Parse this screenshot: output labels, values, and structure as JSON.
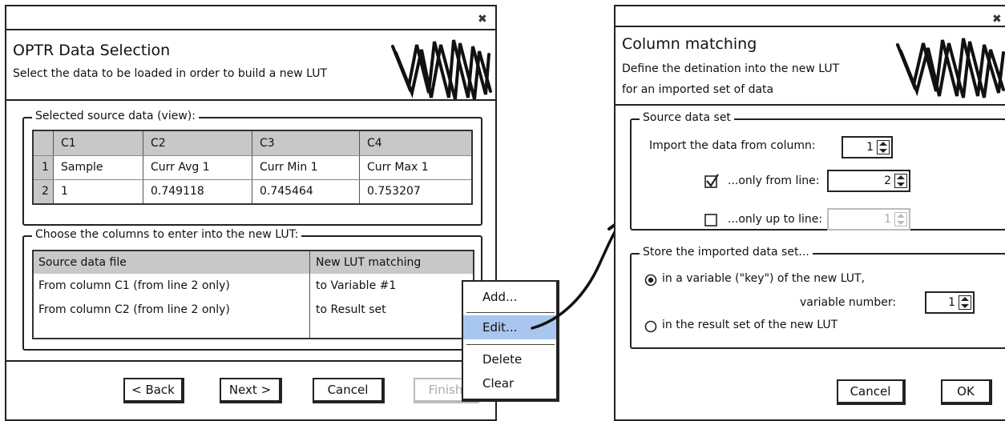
{
  "left": {
    "close_glyph": "✖",
    "title": "OPTR Data Selection",
    "subtitle": "Select the data to be loaded in order to build a new LUT",
    "source_group": {
      "legend": "Selected source data (view):",
      "columns": [
        "C1",
        "C2",
        "C3",
        "C4"
      ],
      "rows": [
        {
          "num": "1",
          "cells": [
            "Sample",
            "Curr Avg 1",
            "Curr Min 1",
            "Curr Max 1"
          ]
        },
        {
          "num": "2",
          "cells": [
            "1",
            "0.749118",
            "0.745464",
            "0.753207"
          ]
        }
      ]
    },
    "columns_group": {
      "legend": "Choose the columns to enter into the new LUT:",
      "headers": [
        "Source data file",
        "New LUT matching"
      ],
      "rows": [
        [
          "From column C1 (from line 2 only)",
          "to Variable #1"
        ],
        [
          "From column C2 (from line 2 only)",
          "to Result set"
        ]
      ]
    },
    "buttons": {
      "back": "< Back",
      "next": "Next >",
      "cancel": "Cancel",
      "finish": "Finish"
    },
    "context_menu": [
      "Add...",
      "Edit...",
      "Delete",
      "Clear"
    ]
  },
  "right": {
    "close_glyph": "✖",
    "title": "Column matching",
    "subtitle_line1": "Define the detination into the new LUT",
    "subtitle_line2": "for an imported set of data",
    "source_set": {
      "legend": "Source data set",
      "import_label": "Import the data from column:",
      "import_value": "1",
      "only_from_label": "...only from line:",
      "only_from_checked": true,
      "only_from_value": "2",
      "only_up_label": "...only up to line:",
      "only_up_checked": false,
      "only_up_value": "1"
    },
    "store_set": {
      "legend": "Store the imported data set...",
      "option_variable": "in a variable (\"key\") of the new LUT,",
      "variable_number_label": "variable number:",
      "variable_number_value": "1",
      "option_result": "in the result set of the new LUT",
      "selected": "variable"
    },
    "buttons": {
      "cancel": "Cancel",
      "ok": "OK"
    }
  },
  "colors": {
    "header_gray": "#c8c8c8",
    "selection_blue": "#a9c7ee",
    "ink": "#222222"
  }
}
